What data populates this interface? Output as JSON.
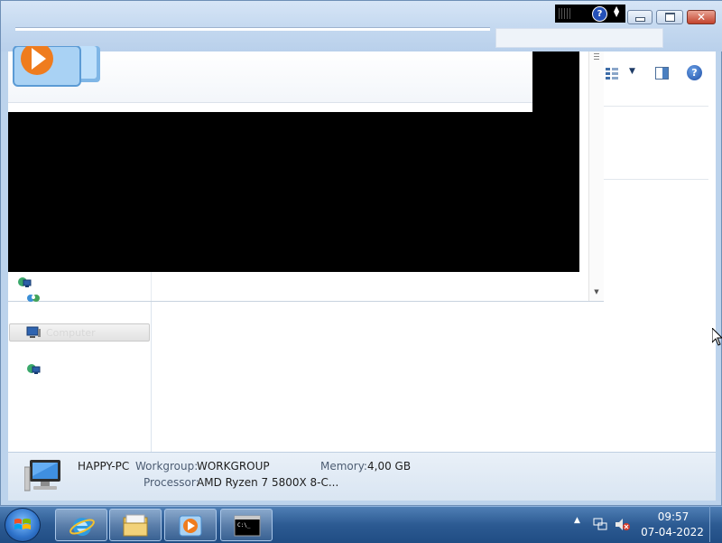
{
  "titlebar": {
    "overlay_help_glyph": "?",
    "minimize_name": "minimize",
    "maximize_name": "maximize",
    "close_glyph": "✕"
  },
  "toolbar": {
    "help_glyph": "?"
  },
  "nav": {
    "computer_label": "Computer"
  },
  "details": {
    "computer_name": "HAPPY-PC",
    "workgroup_label": "Workgroup:",
    "workgroup_value": "WORKGROUP",
    "memory_label": "Memory:",
    "memory_value": "4,00 GB",
    "processor_label": "Processor:",
    "processor_value": "AMD Ryzen 7 5800X 8-C..."
  },
  "taskbar": {
    "pinned": [
      "internet-explorer",
      "windows-explorer",
      "windows-media-player",
      "command-prompt"
    ],
    "clock_time": "09:57",
    "clock_date": "07-04-2022"
  },
  "colors": {
    "taskbar": "#2c5a92",
    "window_chrome": "#c2d7ef",
    "close_button": "#c3432d",
    "blackout": "#000000"
  }
}
